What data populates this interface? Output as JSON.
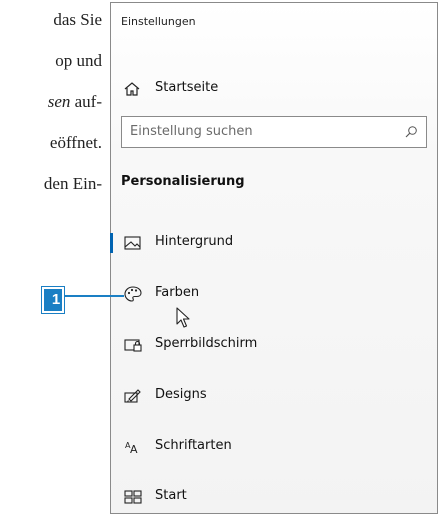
{
  "page_text": {
    "lines": [
      {
        "parts": [
          {
            "t": "das Sie",
            "i": false
          }
        ]
      },
      {
        "parts": [
          {
            "t": "op und",
            "i": false
          }
        ]
      },
      {
        "parts": [
          {
            "t": "sen",
            "i": true
          },
          {
            "t": " auf-",
            "i": false
          }
        ]
      },
      {
        "parts": [
          {
            "t": "eöffnet.",
            "i": false
          }
        ]
      },
      {
        "parts": [
          {
            "t": "den Ein-",
            "i": false
          }
        ]
      }
    ]
  },
  "window": {
    "title": "Einstellungen",
    "home_label": "Startseite",
    "search_placeholder": "Einstellung suchen",
    "section_title": "Personalisierung",
    "nav_items": [
      {
        "label": "Hintergrund",
        "icon": "picture-icon",
        "selected": true
      },
      {
        "label": "Farben",
        "icon": "palette-icon",
        "selected": false
      },
      {
        "label": "Sperrbildschirm",
        "icon": "lock-screen-icon",
        "selected": false
      },
      {
        "label": "Designs",
        "icon": "brush-icon",
        "selected": false
      },
      {
        "label": "Schriftarten",
        "icon": "font-icon",
        "selected": false
      },
      {
        "label": "Start",
        "icon": "start-menu-icon",
        "selected": false
      }
    ]
  },
  "callout": {
    "number": "1"
  },
  "colors": {
    "accent": "#0063b1",
    "callout": "#1a7fc4"
  }
}
